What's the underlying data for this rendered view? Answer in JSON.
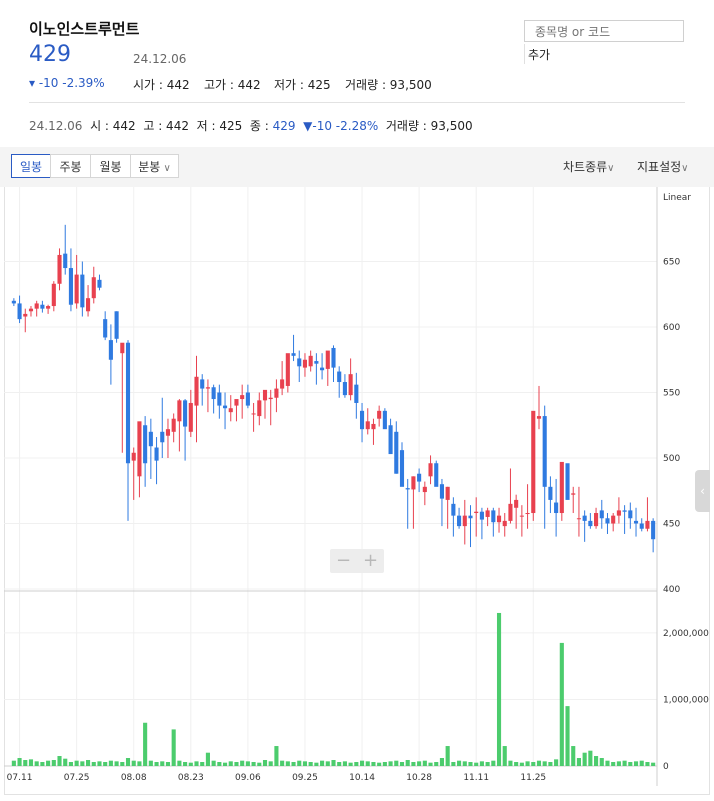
{
  "header": {
    "name": "이노인스트루먼트",
    "price": "429",
    "date": "24.12.06",
    "change": "▾ -10 -2.39%",
    "open_label": "시가",
    "open": "442",
    "high_label": "고가",
    "high": "442",
    "low_label": "저가",
    "low": "425",
    "volume_label": "거래량",
    "volume": "93,500"
  },
  "search": {
    "placeholder": "종목명 or 코드",
    "add_label": "추가"
  },
  "summary": {
    "date": "24.12.06",
    "open": "시 : 442",
    "high": "고 : 442",
    "low": "저 : 425",
    "close_label": "종 : ",
    "close": "429",
    "change": "▼-10 -2.28%",
    "volume": "거래량 : 93,500"
  },
  "toolbar": {
    "tabs": [
      "일봉",
      "주봉",
      "월봉",
      "분봉"
    ],
    "active_tab": "일봉",
    "chart_type": "차트종류",
    "indicator": "지표설정"
  },
  "zoom": {
    "minus": "−",
    "plus": "+"
  },
  "colors": {
    "up": "#e8414f",
    "down": "#2f7ae0",
    "volume": "#4ccc6d",
    "accent": "#2a5bc4"
  },
  "chart_data": {
    "type": "candlestick",
    "price_axis": {
      "label": "Linear",
      "ticks": [
        400,
        450,
        500,
        550,
        600,
        650
      ],
      "ylim": [
        400,
        700
      ]
    },
    "volume_axis": {
      "ticks": [
        "0",
        "1,000,000",
        "2,000,000"
      ],
      "ylim": [
        0,
        2600000
      ]
    },
    "x_tick_labels": [
      "07.11",
      "07.25",
      "08.08",
      "08.23",
      "09.06",
      "09.25",
      "10.14",
      "10.28",
      "11.11",
      "11.25"
    ],
    "x_tick_index": [
      1,
      11,
      21,
      31,
      41,
      51,
      61,
      71,
      81,
      91
    ],
    "candles": [
      [
        620,
        622,
        616,
        618
      ],
      [
        618,
        624,
        603,
        606
      ],
      [
        608,
        614,
        596,
        610
      ],
      [
        612,
        616,
        608,
        614
      ],
      [
        614,
        620,
        608,
        618
      ],
      [
        617,
        620,
        611,
        614
      ],
      [
        614,
        617,
        610,
        616
      ],
      [
        616,
        635,
        612,
        633
      ],
      [
        633,
        660,
        628,
        655
      ],
      [
        656,
        678,
        640,
        645
      ],
      [
        645,
        660,
        612,
        617
      ],
      [
        618,
        655,
        614,
        640
      ],
      [
        640,
        650,
        608,
        615
      ],
      [
        612,
        632,
        608,
        622
      ],
      [
        622,
        646,
        618,
        638
      ],
      [
        636,
        640,
        628,
        630
      ],
      [
        606,
        612,
        590,
        592
      ],
      [
        590,
        602,
        556,
        575
      ],
      [
        612,
        612,
        588,
        591
      ],
      [
        580,
        586,
        504,
        588
      ],
      [
        588,
        590,
        452,
        496
      ],
      [
        498,
        508,
        468,
        504
      ],
      [
        486,
        516,
        470,
        528
      ],
      [
        525,
        532,
        478,
        496
      ],
      [
        520,
        530,
        484,
        509
      ],
      [
        508,
        516,
        480,
        498
      ],
      [
        520,
        546,
        500,
        512
      ],
      [
        517,
        530,
        500,
        522
      ],
      [
        520,
        534,
        512,
        530
      ],
      [
        528,
        545,
        505,
        544
      ],
      [
        544,
        545,
        498,
        524
      ],
      [
        520,
        552,
        516,
        542
      ],
      [
        540,
        578,
        512,
        562
      ],
      [
        560,
        564,
        540,
        553
      ],
      [
        553,
        560,
        535,
        554
      ],
      [
        554,
        556,
        534,
        545
      ],
      [
        550,
        556,
        530,
        540
      ],
      [
        540,
        550,
        522,
        538
      ],
      [
        535,
        548,
        528,
        538
      ],
      [
        540,
        544,
        528,
        545
      ],
      [
        545,
        556,
        530,
        548
      ],
      [
        550,
        556,
        538,
        540
      ],
      [
        534,
        542,
        520,
        534
      ],
      [
        532,
        550,
        525,
        544
      ],
      [
        544,
        550,
        530,
        552
      ],
      [
        545,
        552,
        525,
        546
      ],
      [
        546,
        560,
        535,
        553
      ],
      [
        553,
        574,
        548,
        560
      ],
      [
        555,
        575,
        550,
        580
      ],
      [
        580,
        594,
        574,
        578
      ],
      [
        576,
        582,
        558,
        570
      ],
      [
        569,
        580,
        562,
        575
      ],
      [
        570,
        582,
        566,
        578
      ],
      [
        574,
        580,
        556,
        572
      ],
      [
        569,
        580,
        560,
        567
      ],
      [
        568,
        580,
        555,
        582
      ],
      [
        584,
        586,
        558,
        569
      ],
      [
        566,
        570,
        546,
        558
      ],
      [
        558,
        564,
        546,
        548
      ],
      [
        548,
        576,
        544,
        564
      ],
      [
        556,
        565,
        530,
        542
      ],
      [
        536,
        542,
        512,
        522
      ],
      [
        522,
        538,
        518,
        528
      ],
      [
        522,
        530,
        510,
        526
      ],
      [
        530,
        540,
        524,
        536
      ],
      [
        536,
        538,
        528,
        522
      ],
      [
        525,
        530,
        510,
        503
      ],
      [
        520,
        528,
        488,
        488
      ],
      [
        506,
        512,
        490,
        478
      ],
      [
        477,
        484,
        446,
        476
      ],
      [
        476,
        486,
        446,
        486
      ],
      [
        488,
        492,
        474,
        482
      ],
      [
        474,
        482,
        464,
        478
      ],
      [
        486,
        502,
        480,
        496
      ],
      [
        496,
        498,
        480,
        478
      ],
      [
        480,
        484,
        448,
        469
      ],
      [
        468,
        478,
        446,
        478
      ],
      [
        465,
        470,
        440,
        456
      ],
      [
        456,
        462,
        446,
        448
      ],
      [
        448,
        468,
        434,
        456
      ],
      [
        456,
        464,
        432,
        454
      ],
      [
        458,
        470,
        440,
        459
      ],
      [
        459,
        462,
        438,
        453
      ],
      [
        455,
        462,
        448,
        460
      ],
      [
        460,
        462,
        440,
        451
      ],
      [
        451,
        462,
        443,
        456
      ],
      [
        448,
        458,
        440,
        452
      ],
      [
        452,
        492,
        450,
        465
      ],
      [
        462,
        472,
        446,
        468
      ],
      [
        456,
        464,
        440,
        456
      ],
      [
        458,
        480,
        446,
        458
      ],
      [
        458,
        522,
        452,
        536
      ],
      [
        530,
        555,
        522,
        532
      ],
      [
        532,
        540,
        446,
        478
      ],
      [
        478,
        486,
        458,
        468
      ],
      [
        466,
        484,
        440,
        458
      ],
      [
        458,
        496,
        452,
        497
      ],
      [
        496,
        494,
        472,
        468
      ],
      [
        472,
        478,
        458,
        473
      ],
      [
        454,
        478,
        440,
        454
      ],
      [
        456,
        460,
        436,
        452
      ],
      [
        452,
        458,
        446,
        448
      ],
      [
        448,
        462,
        446,
        458
      ],
      [
        460,
        468,
        446,
        454
      ],
      [
        454,
        458,
        442,
        450
      ],
      [
        450,
        458,
        444,
        456
      ],
      [
        456,
        470,
        450,
        460
      ],
      [
        460,
        464,
        442,
        459
      ],
      [
        460,
        466,
        446,
        454
      ],
      [
        452,
        462,
        440,
        450
      ],
      [
        450,
        454,
        444,
        446
      ],
      [
        446,
        470,
        444,
        452
      ],
      [
        452,
        454,
        428,
        438
      ]
    ],
    "volume": [
      80000,
      120000,
      90000,
      100000,
      70000,
      60000,
      80000,
      90000,
      150000,
      110000,
      60000,
      80000,
      70000,
      90000,
      60000,
      70000,
      60000,
      80000,
      70000,
      60000,
      120000,
      80000,
      70000,
      650000,
      80000,
      60000,
      70000,
      60000,
      550000,
      80000,
      60000,
      50000,
      70000,
      60000,
      200000,
      80000,
      60000,
      50000,
      70000,
      60000,
      80000,
      70000,
      60000,
      50000,
      90000,
      70000,
      300000,
      80000,
      70000,
      60000,
      80000,
      70000,
      60000,
      50000,
      80000,
      70000,
      90000,
      60000,
      70000,
      50000,
      60000,
      80000,
      70000,
      60000,
      50000,
      60000,
      70000,
      80000,
      60000,
      90000,
      60000,
      70000,
      80000,
      50000,
      60000,
      120000,
      300000,
      60000,
      80000,
      70000,
      60000,
      50000,
      70000,
      60000,
      80000,
      2300000,
      300000,
      80000,
      60000,
      50000,
      70000,
      60000,
      80000,
      70000,
      60000,
      100000,
      1850000,
      900000,
      300000,
      120000,
      200000,
      230000,
      150000,
      120000,
      80000,
      60000,
      70000,
      80000,
      60000,
      70000,
      80000,
      60000,
      50000,
      70000,
      80000,
      60000,
      70000
    ]
  }
}
